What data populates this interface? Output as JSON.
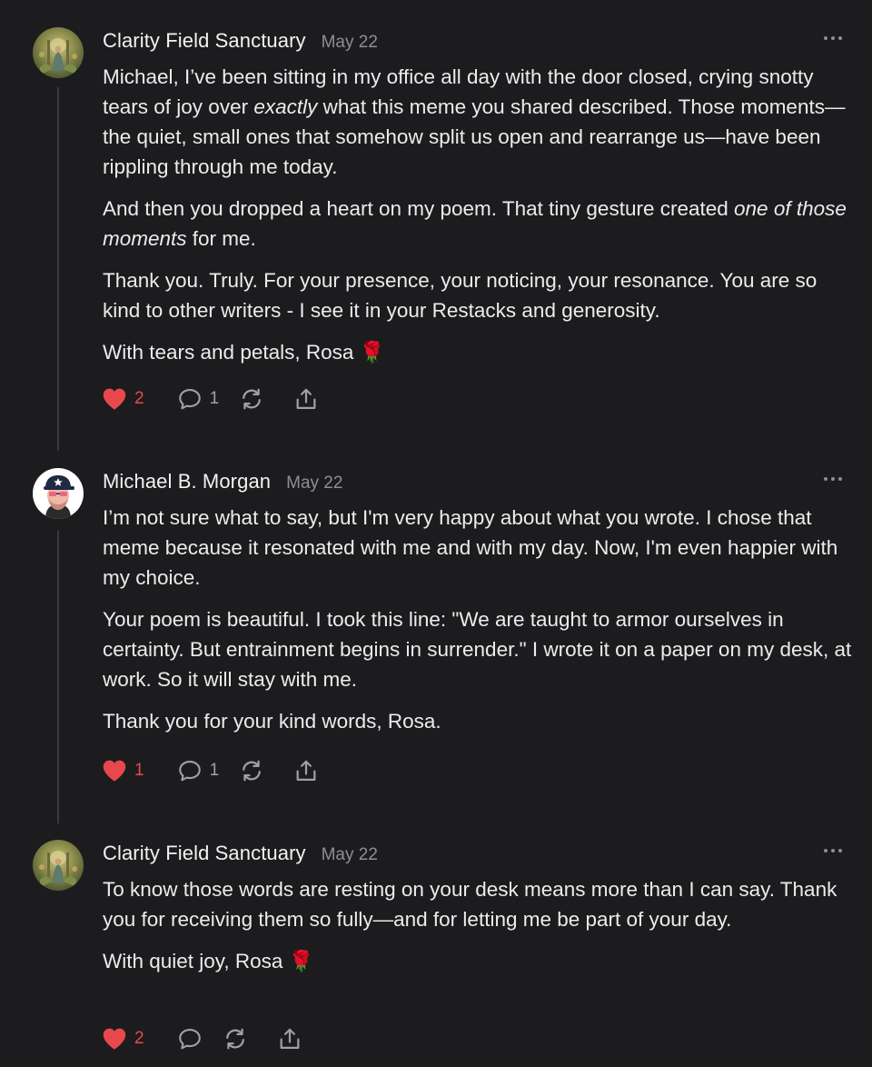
{
  "comments": [
    {
      "author": "Clarity Field Sanctuary",
      "date": "May 22",
      "paragraphs": [
        [
          "Michael, I’ve been sitting in my office all day with the door closed, crying snotty tears of joy over ",
          "exactly",
          " what this meme you shared described. Those moments—the quiet, small ones that somehow split us open and rearrange us—have been rippling through me today."
        ],
        [
          "And then you dropped a heart on my poem. That tiny gesture created ",
          "one of those moments",
          " for me."
        ],
        [
          "Thank you. Truly. For your presence, your noticing, your resonance. You are so kind to other writers - I see it in your Restacks and generosity."
        ],
        [
          "With tears and petals, Rosa ",
          "🌹"
        ]
      ],
      "likes": "2",
      "replies": "1",
      "avatar_icon": "painting-avatar"
    },
    {
      "author": "Michael B. Morgan",
      "date": "May 22",
      "paragraphs": [
        [
          "I’m not sure what to say, but I'm very happy about what you wrote. I chose that meme because it resonated with me and with my day. Now, I'm even happier with my choice."
        ],
        [
          "Your poem is beautiful. I took this line: \"We are taught to armor ourselves in certainty. But entrainment begins in surrender.\" I wrote it on a paper on my desk, at work. So it will stay with me."
        ],
        [
          "Thank you for your kind words, Rosa."
        ]
      ],
      "likes": "1",
      "replies": "1",
      "avatar_icon": "cartoon-man-cap-avatar"
    },
    {
      "author": "Clarity Field Sanctuary",
      "date": "May 22",
      "paragraphs": [
        [
          "To know those words are resting on your desk means more than I can say. Thank you for receiving them so fully—and for letting me be part of your day."
        ],
        [
          "With quiet joy, Rosa ",
          "🌹"
        ]
      ],
      "likes": "2",
      "replies": "",
      "avatar_icon": "painting-avatar"
    }
  ],
  "colors": {
    "background": "#1c1c1e",
    "heart": "#e8484d",
    "muted": "#8e8e93",
    "icon": "#a0a0a5"
  }
}
